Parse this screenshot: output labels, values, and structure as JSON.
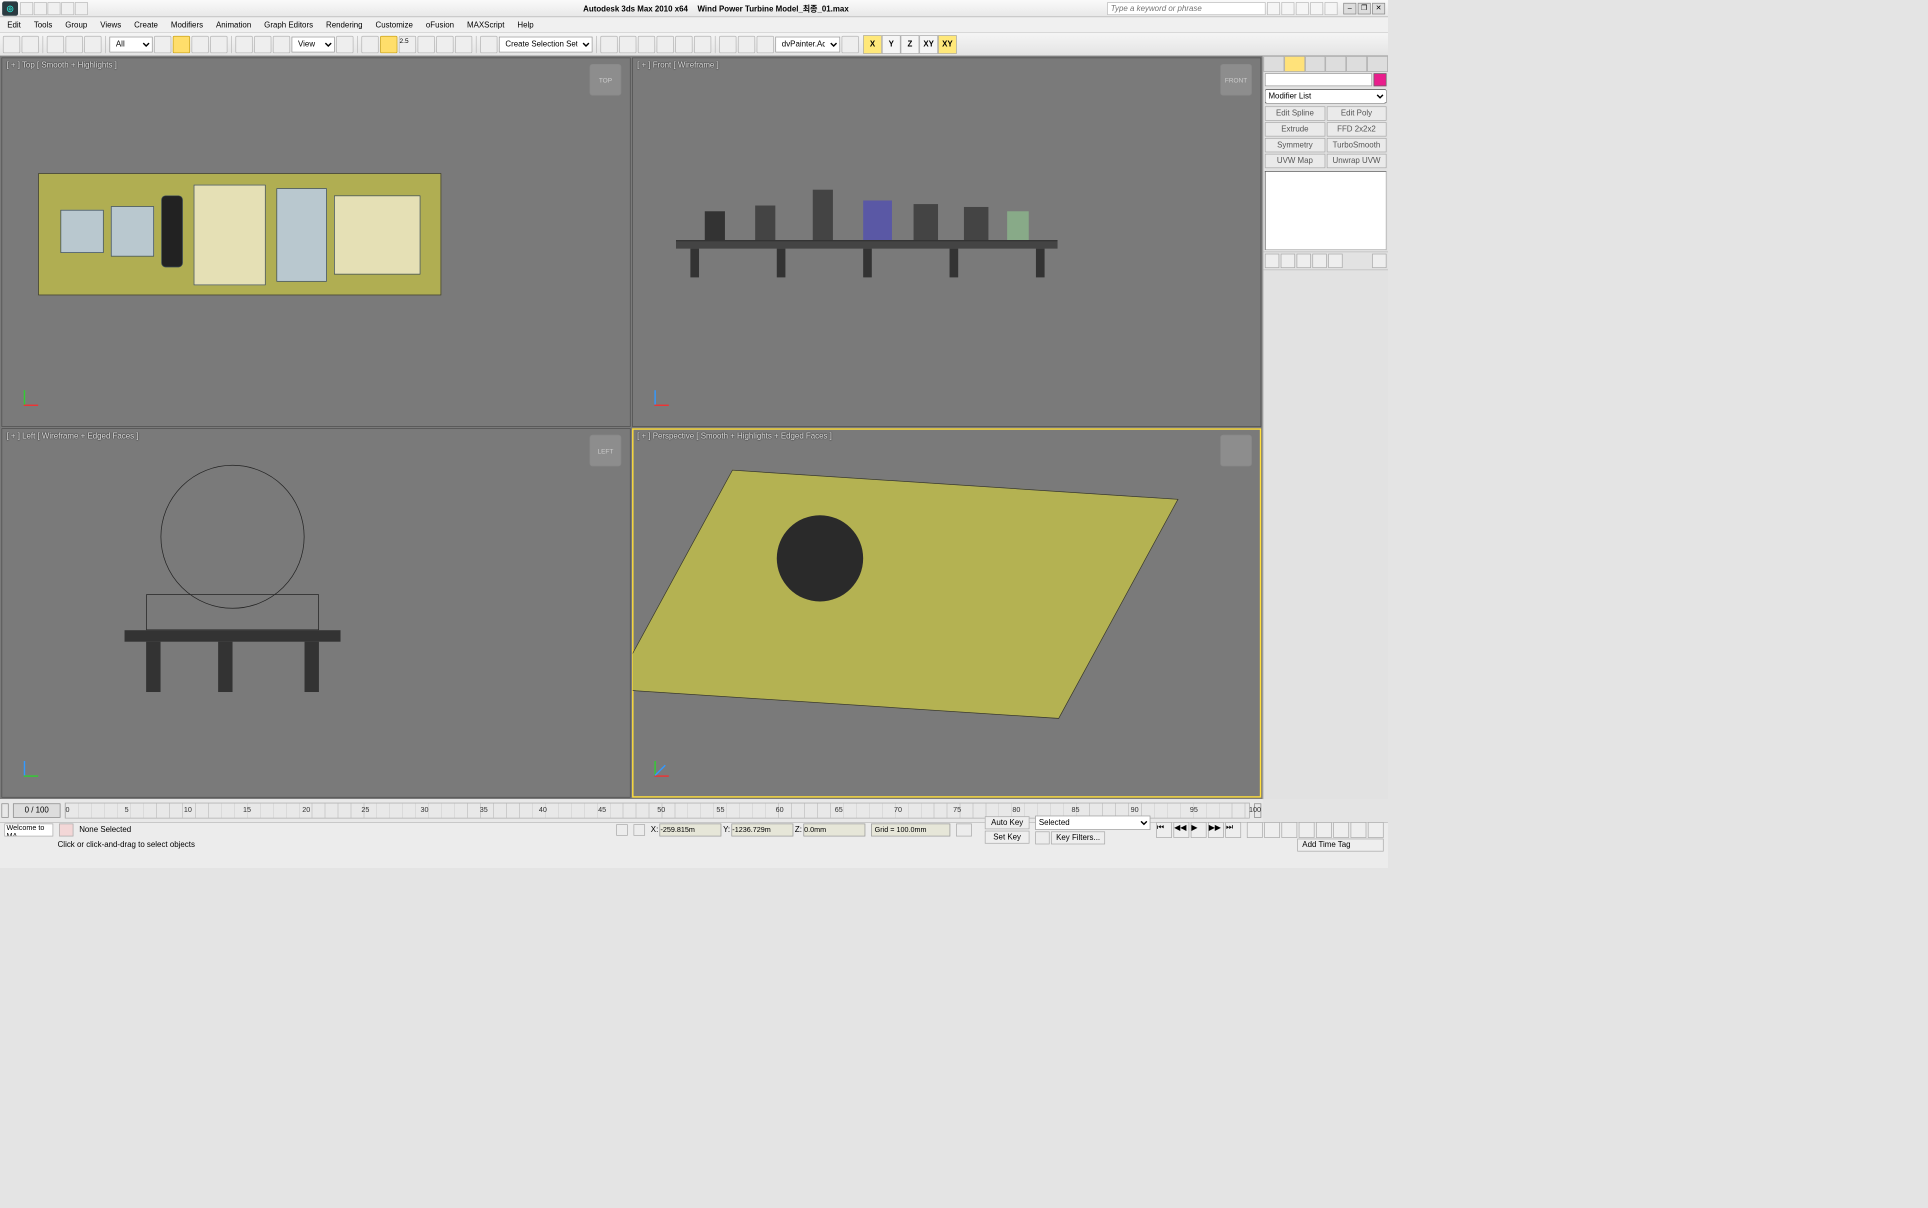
{
  "title": {
    "app": "Autodesk 3ds Max  2010 x64",
    "file": "Wind Power Turbine Model_최종_01.max"
  },
  "find_placeholder": "Type a keyword or phrase",
  "menus": [
    "Edit",
    "Tools",
    "Group",
    "Views",
    "Create",
    "Modifiers",
    "Animation",
    "Graph Editors",
    "Rendering",
    "Customize",
    "oFusion",
    "MAXScript",
    "Help"
  ],
  "toolbar": {
    "nameFilter": "All",
    "viewMode": "View",
    "selSet": "Create Selection Set",
    "advPainter": "dvPainter.Ad",
    "snapNum": "2.5",
    "axes": [
      "X",
      "Y",
      "Z",
      "XY",
      "XY"
    ]
  },
  "viewports": [
    {
      "label": "[ + ] Top [ Smooth + Highlights ]",
      "cube": "TOP"
    },
    {
      "label": "[ + ] Front [ Wireframe ]",
      "cube": "FRONT"
    },
    {
      "label": "[ + ] Left [ Wireframe + Edged Faces ]",
      "cube": "LEFT"
    },
    {
      "label": "[ + ] Perspective [ Smooth + Highlights + Edged Faces ]",
      "cube": ""
    }
  ],
  "cmdpanel": {
    "modifier_list_label": "Modifier List",
    "buttons": [
      "Edit Spline",
      "Edit Poly",
      "Extrude",
      "FFD 2x2x2",
      "Symmetry",
      "TurboSmooth",
      "UVW Map",
      "Unwrap UVW"
    ]
  },
  "timeline": {
    "pos": "0 / 100",
    "ticks": [
      0,
      5,
      10,
      15,
      20,
      25,
      30,
      35,
      40,
      45,
      50,
      55,
      60,
      65,
      70,
      75,
      80,
      85,
      90,
      95,
      100
    ]
  },
  "status": {
    "welcome": "Welcome to MA",
    "selection": "None Selected",
    "hint": "Click or click-and-drag to select objects",
    "x": "-259.815m",
    "y": "-1236.729m",
    "z": "0.0mm",
    "grid": "Grid = 100.0mm",
    "autokey": "Auto Key",
    "setkey": "Set Key",
    "selmode": "Selected",
    "keyfilters": "Key Filters...",
    "addtag": "Add Time Tag"
  }
}
